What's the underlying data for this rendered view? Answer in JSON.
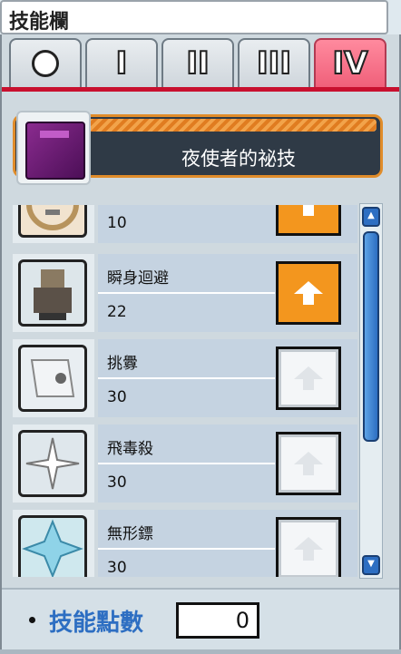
{
  "window": {
    "title": "技能欄"
  },
  "tabs": [
    {
      "label": "○",
      "active": false
    },
    {
      "label": "I",
      "active": false
    },
    {
      "label": "II",
      "active": false
    },
    {
      "label": "III",
      "active": false
    },
    {
      "label": "IV",
      "active": true
    }
  ],
  "job": {
    "name": "夜使者的祕技",
    "icon": "purple-book-icon"
  },
  "skills": [
    {
      "name": "",
      "level": "10",
      "icon": "skill-icon-partial",
      "upgradable": true
    },
    {
      "name": "瞬身迴避",
      "level": "22",
      "icon": "ninja-statue-icon",
      "upgradable": true
    },
    {
      "name": "挑釁",
      "level": "30",
      "icon": "scroll-taunt-icon",
      "upgradable": false
    },
    {
      "name": "飛毒殺",
      "level": "30",
      "icon": "shuriken-burst-icon",
      "upgradable": false
    },
    {
      "name": "無形鏢",
      "level": "30",
      "icon": "ice-shuriken-icon",
      "upgradable": false
    }
  ],
  "footer": {
    "label": "技能點數",
    "points": "0"
  },
  "colors": {
    "accent": "#f3961e",
    "active_tab": "#f0607a",
    "scroll": "#2d6ec2"
  }
}
